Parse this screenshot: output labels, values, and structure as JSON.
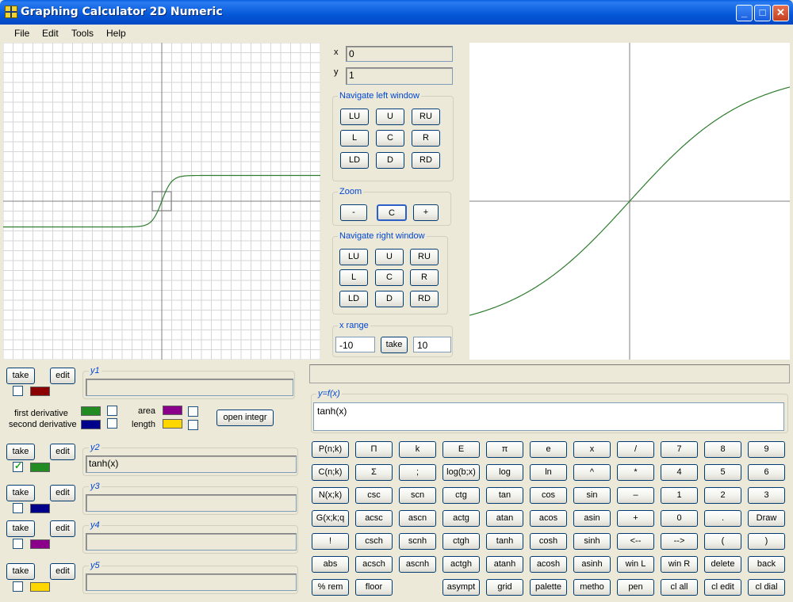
{
  "window": {
    "title": "Graphing Calculator 2D Numeric",
    "minimize": "_",
    "maximize": "□",
    "close": "✕"
  },
  "menu": [
    "File",
    "Edit",
    "Tools",
    "Help"
  ],
  "coords": {
    "x_label": "x",
    "x_value": "0",
    "y_label": "y",
    "y_value": "1"
  },
  "nav_left": {
    "title": "Navigate left window",
    "buttons": [
      "LU",
      "U",
      "RU",
      "L",
      "C",
      "R",
      "LD",
      "D",
      "RD"
    ]
  },
  "zoom": {
    "title": "Zoom",
    "buttons": [
      "-",
      "C",
      "+"
    ]
  },
  "nav_right": {
    "title": "Navigate right window",
    "buttons": [
      "LU",
      "U",
      "RU",
      "L",
      "C",
      "R",
      "LD",
      "D",
      "RD"
    ]
  },
  "x_range": {
    "title": "x range",
    "min": "-10",
    "take": "take",
    "max": "10"
  },
  "status_bar": "",
  "yf": {
    "legend": "y=f(x)",
    "value": "tanh(x)"
  },
  "functions": [
    {
      "legend": "y1",
      "value": "",
      "take": "take",
      "edit": "edit",
      "checked": false,
      "color": "#8b0000"
    },
    {
      "legend": "y2",
      "value": "tanh(x)",
      "take": "take",
      "edit": "edit",
      "checked": true,
      "color": "#228b22"
    },
    {
      "legend": "y3",
      "value": "",
      "take": "take",
      "edit": "edit",
      "checked": false,
      "color": "#00008b"
    },
    {
      "legend": "y4",
      "value": "",
      "take": "take",
      "edit": "edit",
      "checked": false,
      "color": "#8b008b"
    },
    {
      "legend": "y5",
      "value": "",
      "take": "take",
      "edit": "edit",
      "checked": false,
      "color": "#ffd700"
    }
  ],
  "derivatives": {
    "first": "first derivative",
    "first_color": "#228b22",
    "second": "second derivative",
    "second_color": "#00008b",
    "area": "area",
    "area_color": "#8b008b",
    "length": "length",
    "length_color": "#ffd700",
    "open_integr": "open integr"
  },
  "keypad": [
    [
      "P(n;k)",
      "Π",
      "k",
      "E",
      "π",
      "e",
      "x",
      "/",
      "7",
      "8",
      "9"
    ],
    [
      "C(n;k)",
      "Σ",
      ";",
      "log(b;x)",
      "log",
      "ln",
      "^",
      "*",
      "4",
      "5",
      "6"
    ],
    [
      "N(x;k)",
      "csc",
      "scn",
      "ctg",
      "tan",
      "cos",
      "sin",
      "–",
      "1",
      "2",
      "3"
    ],
    [
      "G(x;k;q",
      "acsc",
      "ascn",
      "actg",
      "atan",
      "acos",
      "asin",
      "+",
      "0",
      ".",
      "Draw"
    ],
    [
      "!",
      "csch",
      "scnh",
      "ctgh",
      "tanh",
      "cosh",
      "sinh",
      "<--",
      "-->",
      "(",
      ")"
    ],
    [
      "abs",
      "acsch",
      "ascnh",
      "actgh",
      "atanh",
      "acosh",
      "asinh",
      "win L",
      "win R",
      "delete",
      "back"
    ],
    [
      "% rem",
      "floor",
      "",
      "asympt",
      "grid",
      "palette",
      "metho",
      "pen",
      "cl all",
      "cl edit",
      "cl dial"
    ]
  ],
  "colors": {
    "curve": "#2e7d2e",
    "grid": "#d6d6d6",
    "axis": "#7f7f7f",
    "accent": "#0046d5"
  }
}
